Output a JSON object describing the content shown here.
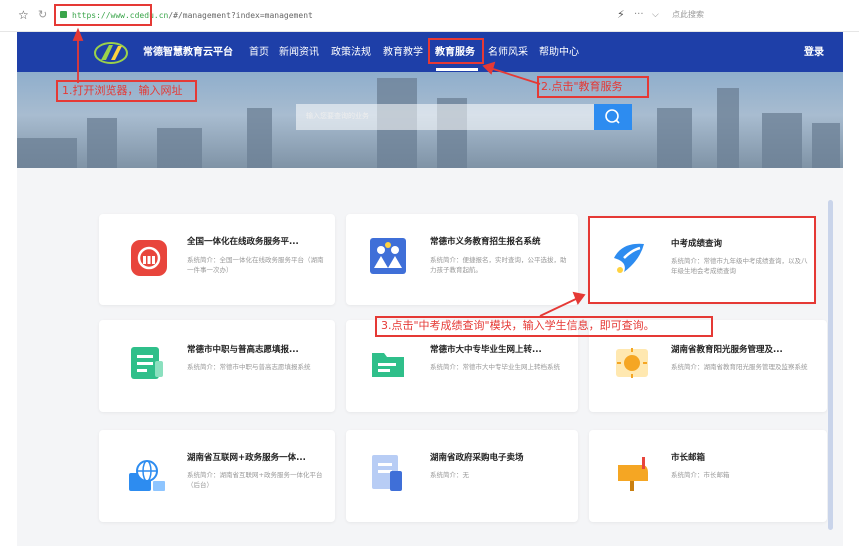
{
  "browser": {
    "url_host": "https://www.cdedu.cn",
    "url_path": "/#/management?index=management",
    "search_placeholder": "点此搜索",
    "more": "···",
    "dropdown": "⌵"
  },
  "nav": {
    "site_title": "常德智慧教育云平台",
    "items": [
      {
        "label": "首页"
      },
      {
        "label": "新闻资讯"
      },
      {
        "label": "政策法规"
      },
      {
        "label": "教育教学"
      },
      {
        "label": "教育服务"
      },
      {
        "label": "名师风采"
      },
      {
        "label": "帮助中心"
      }
    ],
    "login": "登录"
  },
  "banner": {
    "search_placeholder": "输入您要查询的业务"
  },
  "cards": [
    {
      "title": "全国一体化在线政务服务平...",
      "desc": "系统简介：全国一体化在线政务服务平台（湖南一件事一次办）",
      "icon": "bank-icon",
      "color": "#e8453c"
    },
    {
      "title": "常德市义务教育招生报名系统",
      "desc": "系统简介：便捷报名，实时查询，公平选拔，助力孩子教育起航。",
      "icon": "students-icon",
      "color": "#3f6fd8"
    },
    {
      "title": "中考成绩查询",
      "desc": "系统简介：常德市九年级中考成绩查询，以及八年级生地会考成绩查询",
      "icon": "paper-plane-icon",
      "color": "#2d8cf0"
    },
    {
      "title": "常德市中职与普高志愿填报...",
      "desc": "系统简介：常德市中职与普高志愿填报系统",
      "icon": "form-icon",
      "color": "#2fbf8a"
    },
    {
      "title": "常德市大中专毕业生网上转...",
      "desc": "系统简介：常德市大中专毕业生网上转档系统",
      "icon": "folder-icon",
      "color": "#2fbf8a"
    },
    {
      "title": "湖南省教育阳光服务管理及...",
      "desc": "系统简介：湖南省教育阳光服务管理及监察系统",
      "icon": "sun-icon",
      "color": "#f5a623"
    },
    {
      "title": "湖南省互联网+政务服务一体...",
      "desc": "系统简介：湖南省互联网+政务服务一体化平台（后台）",
      "icon": "globe-icon",
      "color": "#2d8cf0"
    },
    {
      "title": "湖南省政府采购电子卖场",
      "desc": "系统简介：无",
      "icon": "document-icon",
      "color": "#3f6fd8"
    },
    {
      "title": "市长邮箱",
      "desc": "系统简介：市长邮箱",
      "icon": "mailbox-icon",
      "color": "#f5a623"
    }
  ],
  "annotations": {
    "step1": "1.打开浏览器，输入网址",
    "step2": "2.点击\"教育服务",
    "step3": "3.点击\"中考成绩查询\"模块，输入学生信息，即可查询。"
  }
}
